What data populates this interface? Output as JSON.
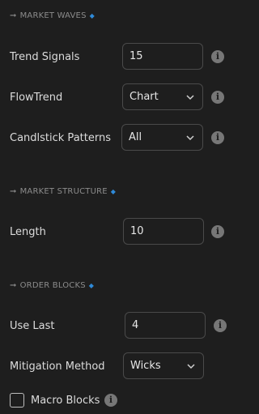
{
  "sections": {
    "market_waves": {
      "title": "MARKET WAVES"
    },
    "market_structure": {
      "title": "MARKET STRUCTURE"
    },
    "order_blocks": {
      "title": "ORDER BLOCKS"
    }
  },
  "fields": {
    "trend_signals": {
      "label": "Trend Signals",
      "value": "15"
    },
    "flowtrend": {
      "label": "FlowTrend",
      "value": "Chart"
    },
    "candlestick_patterns": {
      "label": "Candlstick Patterns",
      "value": "All"
    },
    "length": {
      "label": "Length",
      "value": "10"
    },
    "use_last": {
      "label": "Use Last",
      "value": "4"
    },
    "mitigation_method": {
      "label": "Mitigation Method",
      "value": "Wicks"
    },
    "macro_blocks": {
      "label": "Macro Blocks",
      "checked": false
    }
  },
  "icons": {
    "arrow": "arrow-right-icon",
    "diamond": "diamond-icon",
    "info": "info-icon",
    "chevron": "chevron-down-icon"
  },
  "colors": {
    "background": "#1e1e1e",
    "accent": "#2f8ad8",
    "border": "#4a4a4a",
    "info_icon": "#777777"
  }
}
